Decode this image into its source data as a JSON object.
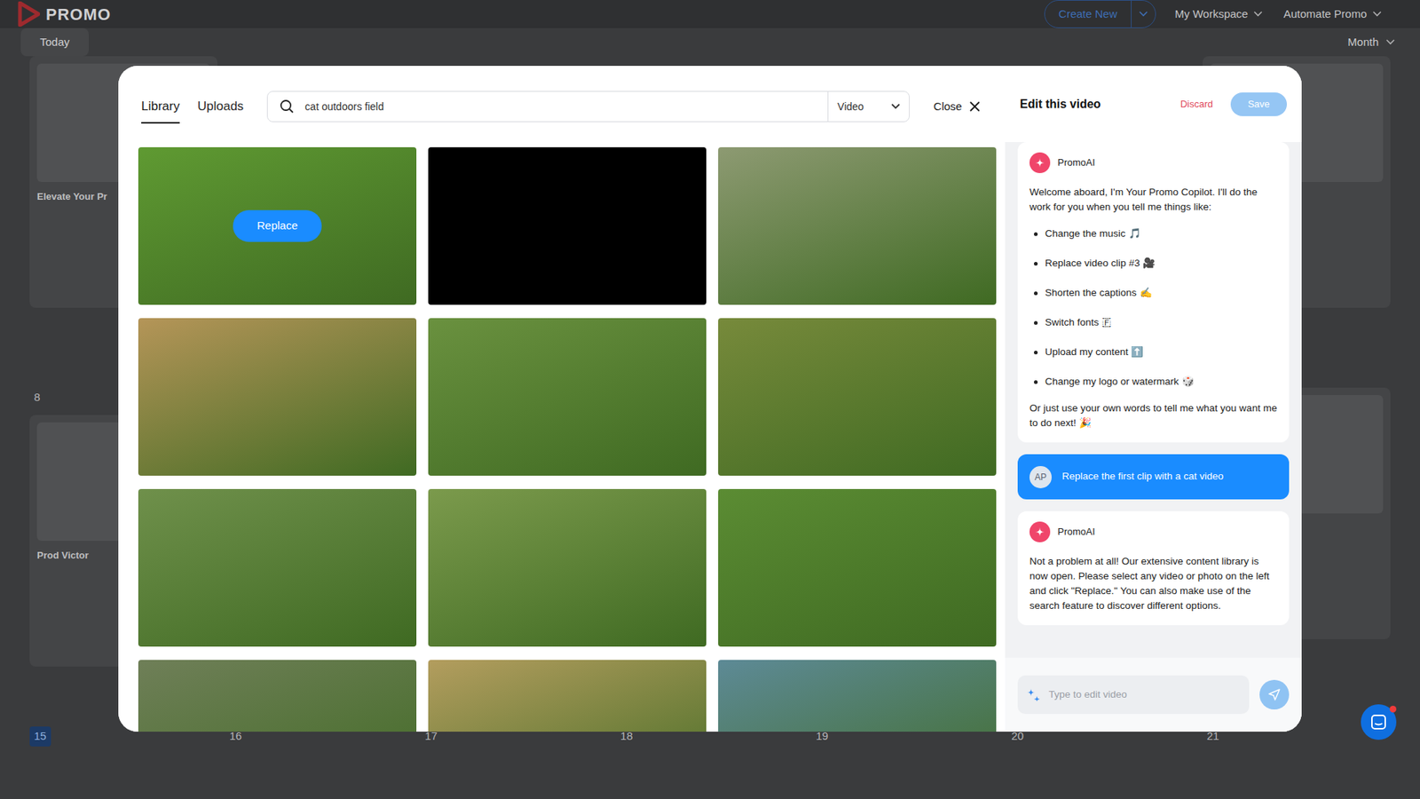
{
  "app": {
    "logo": "PROMO",
    "create_button": "Create New",
    "nav": [
      "My Workspace",
      "Automate Promo"
    ]
  },
  "toolbar": {
    "today": "Today",
    "view": "Month"
  },
  "calendar": {
    "rows": [
      {
        "cells": [
          {
            "day": "",
            "kind": "card",
            "title": "Elevate Your Pr",
            "today": false
          },
          {
            "day": "",
            "kind": "empty",
            "title": "",
            "today": false
          },
          {
            "day": "",
            "kind": "empty",
            "title": "",
            "today": false
          },
          {
            "day": "",
            "kind": "empty",
            "title": "",
            "today": false
          },
          {
            "day": "",
            "kind": "empty",
            "title": "",
            "today": false
          },
          {
            "day": "",
            "kind": "empty",
            "title": "",
            "today": false
          },
          {
            "day": "",
            "kind": "card",
            "title": "",
            "today": false
          }
        ]
      },
      {
        "cells": [
          {
            "day": "8",
            "kind": "card",
            "title": "Prod Victor",
            "today": false
          },
          {
            "day": "",
            "kind": "empty",
            "title": "",
            "today": false
          },
          {
            "day": "",
            "kind": "empty",
            "title": "",
            "today": false
          },
          {
            "day": "",
            "kind": "empty",
            "title": "",
            "today": false
          },
          {
            "day": "",
            "kind": "empty",
            "title": "",
            "today": false
          },
          {
            "day": "",
            "kind": "empty",
            "title": "",
            "today": false
          },
          {
            "day": "",
            "kind": "card",
            "title": "",
            "today": false
          }
        ]
      },
      {
        "cells": [
          {
            "day": "15",
            "kind": "empty",
            "title": "",
            "today": true
          },
          {
            "day": "16",
            "kind": "empty",
            "title": "",
            "today": false
          },
          {
            "day": "17",
            "kind": "empty",
            "title": "",
            "today": false
          },
          {
            "day": "18",
            "kind": "empty",
            "title": "",
            "today": false
          },
          {
            "day": "19",
            "kind": "empty",
            "title": "",
            "today": false
          },
          {
            "day": "20",
            "kind": "empty",
            "title": "",
            "today": false
          },
          {
            "day": "21",
            "kind": "empty",
            "title": "",
            "today": false
          }
        ]
      }
    ]
  },
  "library": {
    "tabs": [
      {
        "label": "Library",
        "selected": true
      },
      {
        "label": "Uploads",
        "selected": false
      }
    ],
    "search": {
      "value": "cat outdoors field"
    },
    "media_type": "Video",
    "close": "Close",
    "replace_label": "Replace",
    "tiles": [
      {
        "kind": "video",
        "hovered": true
      },
      {
        "kind": "loading",
        "hovered": false
      },
      {
        "kind": "video",
        "hovered": false
      },
      {
        "kind": "video",
        "hovered": false
      },
      {
        "kind": "video",
        "hovered": false
      },
      {
        "kind": "video",
        "hovered": false
      },
      {
        "kind": "video",
        "hovered": false
      },
      {
        "kind": "video",
        "hovered": false
      },
      {
        "kind": "video",
        "hovered": false
      },
      {
        "kind": "video",
        "hovered": false
      },
      {
        "kind": "video",
        "hovered": false
      },
      {
        "kind": "video",
        "hovered": false
      }
    ]
  },
  "editor": {
    "title": "Edit this video",
    "discard": "Discard",
    "save": "Save",
    "save_disabled": true
  },
  "chat": {
    "messages": [
      {
        "role": "assistant",
        "sender": "PromoAI",
        "intro": "Welcome aboard, I'm Your Promo Copilot. I'll do the work for you when you tell me things like:",
        "bullets": [
          "Change the music 🎵",
          "Replace video clip #3 🎥",
          "Shorten the captions ✍️",
          "Switch fonts 🇫",
          "Upload my content ⬆️",
          "Change my logo or watermark 🎲"
        ],
        "outro": "Or just use your own words to tell me what you want me to do next! 🎉"
      },
      {
        "role": "user",
        "avatar": "AP",
        "text": "Replace the first clip with a cat video"
      },
      {
        "role": "assistant",
        "sender": "PromoAI",
        "intro": "Not a problem at all! Our extensive content library is now open. Please select any video or photo on the left and click \"Replace.\" You can also make use of the search feature to discover different options.",
        "bullets": [],
        "outro": ""
      }
    ],
    "input": {
      "placeholder": "Type to edit video"
    }
  }
}
